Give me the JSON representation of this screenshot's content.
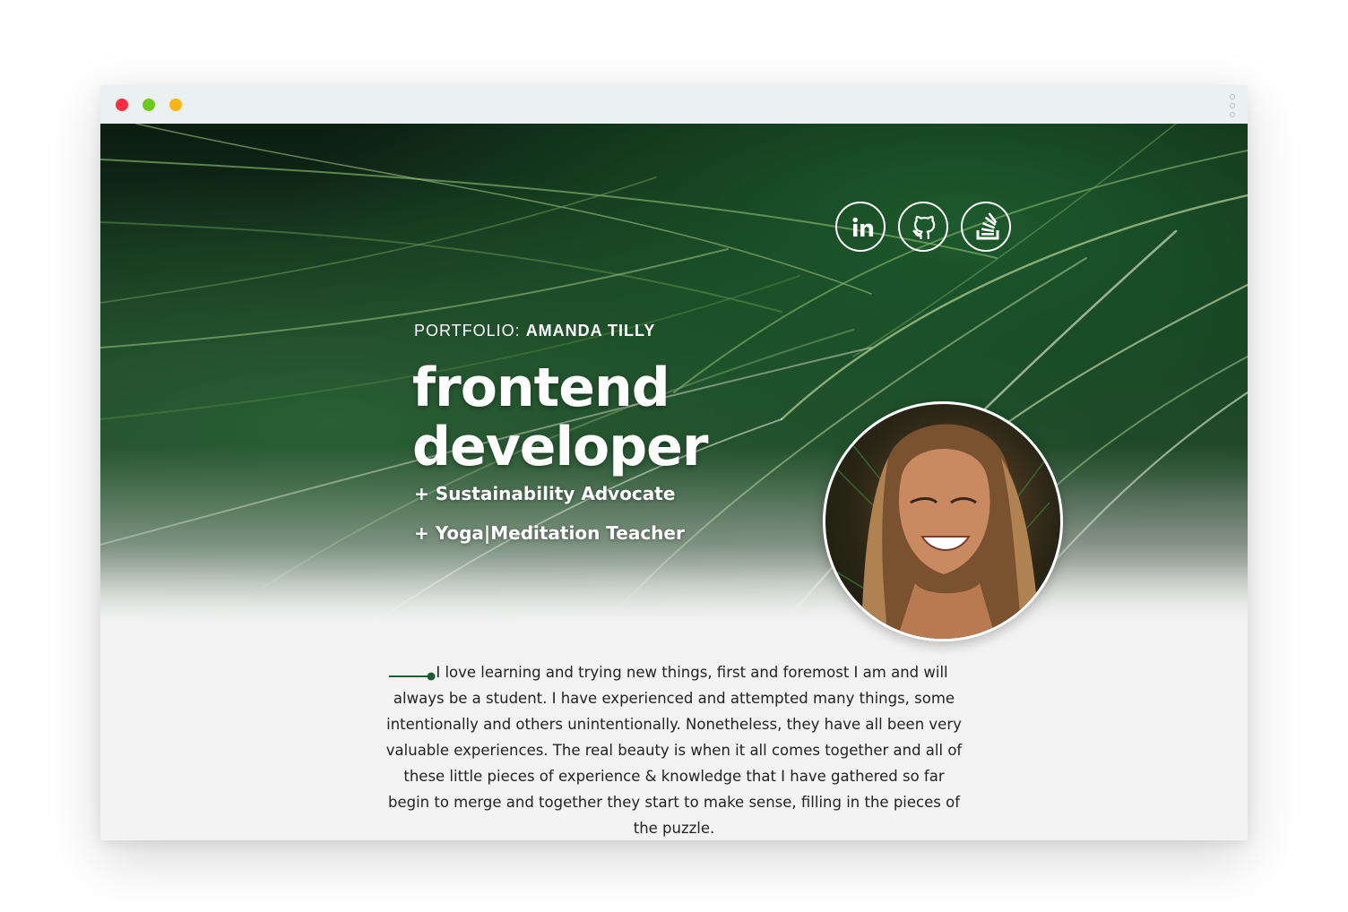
{
  "window": {
    "traffic_lights": [
      "close",
      "maximize",
      "minimize"
    ],
    "colors": {
      "close": "#fe2f40",
      "green": "#6cca1a",
      "yellow": "#fbb514"
    }
  },
  "social": [
    {
      "name": "LinkedIn",
      "icon": "linkedin-icon"
    },
    {
      "name": "GitHub",
      "icon": "github-icon"
    },
    {
      "name": "Stack Overflow",
      "icon": "stackoverflow-icon"
    }
  ],
  "hero": {
    "kicker_prefix": "PORTFOLIO:",
    "kicker_name": "AMANDA TILLY",
    "title_line1": "frontend",
    "title_line2": "developer",
    "role1": "+ Sustainability Advocate",
    "role2": "+ Yoga|Meditation Teacher"
  },
  "bio": {
    "text": "I love learning and trying new things, first and foremost I am and will always be a student. I have experienced and attempted many things, some intentionally and others unintentionally. Nonetheless, they have all been very valuable experiences. The real beauty is when it all comes together and all of these little pieces of experience & knowledge that I have gathered so far begin to merge and together they start to make sense, filling in the pieces of the puzzle.",
    "accent_color": "#1e5c34"
  }
}
